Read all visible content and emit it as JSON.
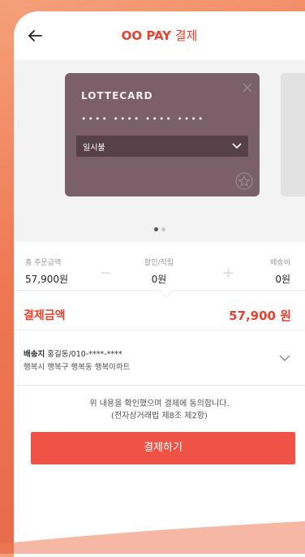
{
  "header": {
    "title_brand": "OO PAY",
    "title_rest": "결제"
  },
  "card": {
    "brand": "LOTTECARD",
    "number_masked": "•••• •••• •••• ••••",
    "installment": "일시불",
    "color": "#7b6069"
  },
  "carousel": {
    "dots": 2,
    "active_dot": 1
  },
  "summary": {
    "total_label": "총 주문금액",
    "total_value": "57,900원",
    "discount_label": "할인/적립",
    "discount_value": "0원",
    "shipping_label": "배송비",
    "shipping_value": "0원",
    "minus": "−",
    "plus": "+"
  },
  "payment": {
    "label": "결제금액",
    "value": "57,900 원"
  },
  "shipping": {
    "tag": "배송지",
    "recipient": "홍길동/010-****-****",
    "address": "행복시 행복구 행복동 행복아파트"
  },
  "agreement": {
    "line1": "위 내용을 확인했으며 결제에 동의합니다.",
    "line2": "(전자상거래법 제8조 제2항)"
  },
  "pay_button": {
    "label": "결제하기",
    "color": "#ef5346"
  },
  "colors": {
    "accent": "#e8412f",
    "background": "#ee7652"
  },
  "icons": {
    "back": "arrow-left-icon",
    "close": "close-icon",
    "installment_chevron": "chevron-down-icon",
    "favorite": "star-icon",
    "shipping_chevron": "chevron-down-icon"
  }
}
